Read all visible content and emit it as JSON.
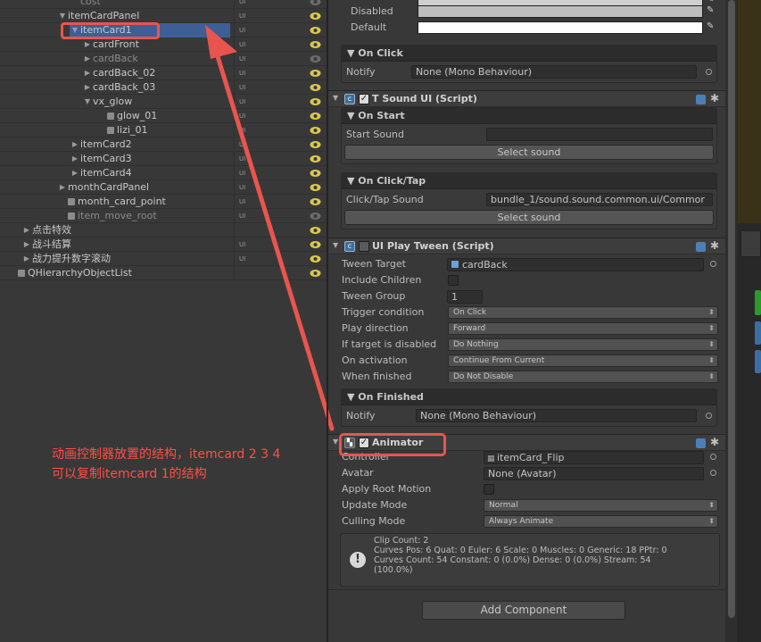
{
  "hierarchy": {
    "rows": [
      {
        "label": "cost",
        "layer": "UI",
        "indent": 78,
        "arrow": "",
        "cube": false,
        "dim": true
      },
      {
        "label": "itemCardPanel",
        "layer": "UI",
        "indent": 64,
        "arrow": "▼",
        "cube": false,
        "dim": false
      },
      {
        "label": "itemCard1",
        "layer": "UI",
        "indent": 78,
        "arrow": "▼",
        "cube": false,
        "dim": false,
        "selected": true
      },
      {
        "label": "cardFront",
        "layer": "UI",
        "indent": 92,
        "arrow": "▶",
        "cube": false,
        "dim": false
      },
      {
        "label": "cardBack",
        "layer": "UI",
        "indent": 92,
        "arrow": "▶",
        "cube": false,
        "dim": true
      },
      {
        "label": "cardBack_02",
        "layer": "UI",
        "indent": 92,
        "arrow": "▶",
        "cube": false,
        "dim": false
      },
      {
        "label": "cardBack_03",
        "layer": "UI",
        "indent": 92,
        "arrow": "▶",
        "cube": false,
        "dim": false
      },
      {
        "label": "vx_glow",
        "layer": "UI",
        "indent": 92,
        "arrow": "▼",
        "cube": false,
        "dim": false
      },
      {
        "label": "glow_01",
        "layer": "UI",
        "indent": 108,
        "arrow": "",
        "cube": true,
        "dim": false
      },
      {
        "label": "lizi_01",
        "layer": "UI",
        "indent": 108,
        "arrow": "",
        "cube": true,
        "dim": false
      },
      {
        "label": "itemCard2",
        "layer": "UI",
        "indent": 78,
        "arrow": "▶",
        "cube": false,
        "dim": false
      },
      {
        "label": "itemCard3",
        "layer": "UI",
        "indent": 78,
        "arrow": "▶",
        "cube": false,
        "dim": false
      },
      {
        "label": "itemCard4",
        "layer": "UI",
        "indent": 78,
        "arrow": "▶",
        "cube": false,
        "dim": false
      },
      {
        "label": "monthCardPanel",
        "layer": "UI",
        "indent": 64,
        "arrow": "▶",
        "cube": false,
        "dim": false
      },
      {
        "label": "month_card_point",
        "layer": "UI",
        "indent": 64,
        "arrow": "",
        "cube": true,
        "dim": false
      },
      {
        "label": "item_move_root",
        "layer": "UI",
        "indent": 64,
        "arrow": "",
        "cube": true,
        "dim": true
      },
      {
        "label": "点击特效",
        "layer": "",
        "indent": 24,
        "arrow": "▶",
        "cube": false,
        "dim": false
      },
      {
        "label": "战斗结算",
        "layer": "UI",
        "indent": 24,
        "arrow": "▶",
        "cube": false,
        "dim": false
      },
      {
        "label": "战力提升数字滚动",
        "layer": "UI",
        "indent": 24,
        "arrow": "▶",
        "cube": false,
        "dim": false
      },
      {
        "label": "QHierarchyObjectList",
        "layer": "",
        "indent": 8,
        "arrow": "",
        "cube": true,
        "dim": false
      }
    ]
  },
  "inspector": {
    "disabled_label": "Disabled",
    "default_label": "Default",
    "on_click": {
      "header": "On Click",
      "notify_label": "Notify",
      "notify_value": "None (Mono Behaviour)"
    },
    "tsound": {
      "title": "T Sound UI (Script)",
      "on_start": "On Start",
      "start_sound_label": "Start Sound",
      "start_sound_value": "",
      "select_sound": "Select sound",
      "on_click_tap": "On Click/Tap",
      "click_tap_label": "Click/Tap Sound",
      "click_tap_value": "bundle_1/sound.sound.common.ui/Commor",
      "select_sound2": "Select sound"
    },
    "tween": {
      "title": "UI Play Tween (Script)",
      "target_label": "Tween Target",
      "target_value": "cardBack",
      "include_label": "Include Children",
      "group_label": "Tween Group",
      "group_value": "1",
      "trigger_label": "Trigger condition",
      "trigger_value": "On Click",
      "direction_label": "Play direction",
      "direction_value": "Forward",
      "disabled_label": "If target is disabled",
      "disabled_value": "Do Nothing",
      "activation_label": "On activation",
      "activation_value": "Continue From Current",
      "finished_label": "When finished",
      "finished_value": "Do Not Disable",
      "on_finished": "On Finished",
      "notify_label": "Notify",
      "notify_value": "None (Mono Behaviour)"
    },
    "animator": {
      "title": "Animator",
      "controller_label": "Controller",
      "controller_value": "itemCard_Flip",
      "avatar_label": "Avatar",
      "avatar_value": "None (Avatar)",
      "root_motion_label": "Apply Root Motion",
      "update_label": "Update Mode",
      "update_value": "Normal",
      "culling_label": "Culling Mode",
      "culling_value": "Always Animate",
      "info": "Clip Count: 2\nCurves Pos: 6 Quat: 0 Euler: 6 Scale: 0 Muscles: 0 Generic: 18 PPtr: 0\nCurves Count: 54 Constant: 0 (0.0%) Dense: 0 (0.0%) Stream: 54\n(100.0%)"
    },
    "add_component": "Add Component"
  },
  "annotation": {
    "text": "动画控制器放置的结构，itemcard  2 3 4\n可以复制itemcard 1的结构",
    "color": "#e8554f"
  },
  "colors": {
    "selection": "#3e5f96",
    "eye": "#d9c84a",
    "panel": "#383838"
  }
}
